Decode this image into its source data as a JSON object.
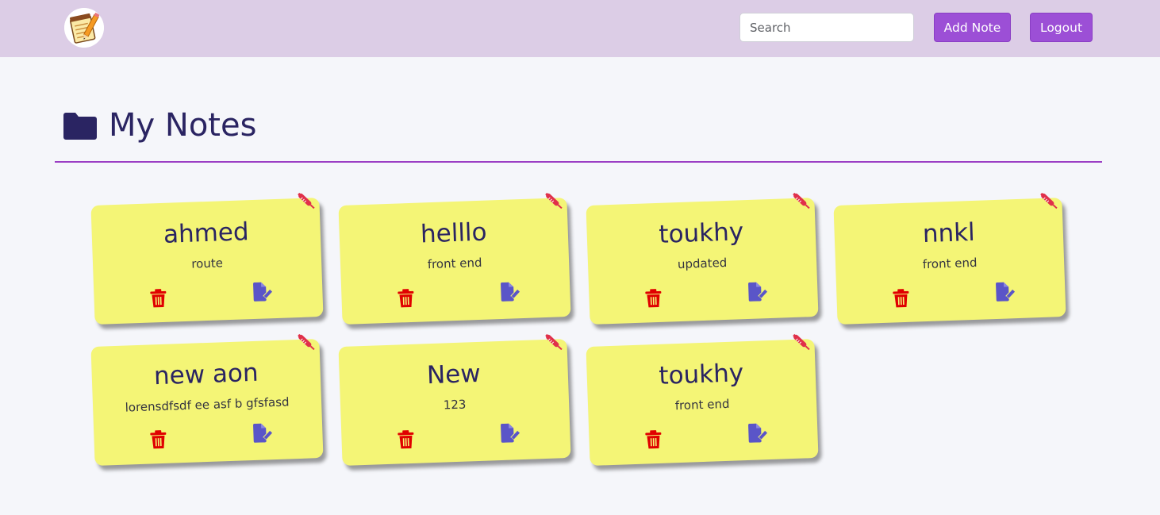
{
  "app": {
    "logo_icon": "notepad-pencil-icon"
  },
  "header": {
    "search": {
      "placeholder": "Search",
      "value": ""
    },
    "add_note_label": "Add Note",
    "logout_label": "Logout",
    "accent_color": "#9c4fd6",
    "background_color": "#dccde6"
  },
  "main": {
    "title": "My Notes",
    "title_icon": "folder-icon"
  },
  "notes": [
    {
      "title": "ahmed",
      "description": "route"
    },
    {
      "title": "helllo",
      "description": "front end"
    },
    {
      "title": "toukhy",
      "description": "updated"
    },
    {
      "title": "nnkl",
      "description": "front end"
    },
    {
      "title": "new aon",
      "description": "lorensdfsdf ee asf b gfsfasd"
    },
    {
      "title": "New",
      "description": "123"
    },
    {
      "title": "toukhy",
      "description": "front end"
    }
  ],
  "note_style": {
    "background_color": "#f4f576",
    "delete_icon": "trash-icon",
    "edit_icon": "edit-icon",
    "pin_icon": "pin-icon",
    "delete_color": "#e00000",
    "edit_color": "#5a55c8"
  }
}
